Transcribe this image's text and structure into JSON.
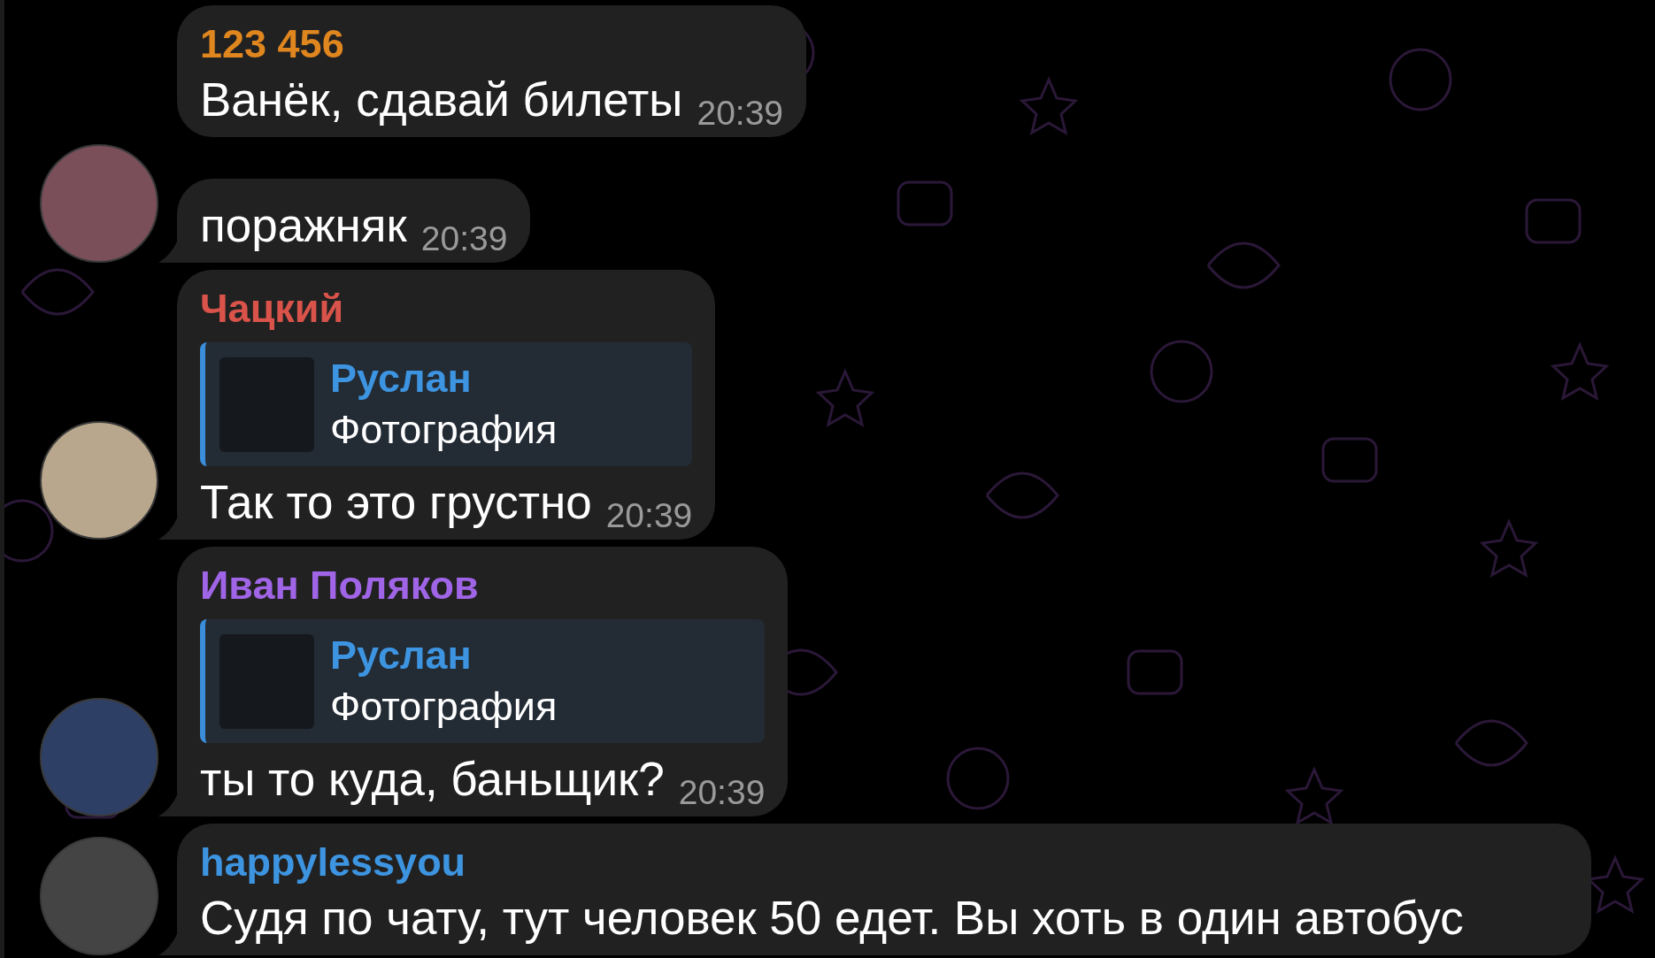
{
  "messages": [
    {
      "sender": "123 456",
      "color": "#e0861f",
      "text": "Ванёк, сдавай билеты",
      "time": "20:39",
      "avatar": false
    },
    {
      "text": "поражняк",
      "time": "20:39",
      "avatar": true
    },
    {
      "sender": "Чацкий",
      "color": "#d9534a",
      "reply": {
        "author": "Руслан",
        "text": "Фотография"
      },
      "text": "Так то это грустно",
      "time": "20:39",
      "avatar": true
    },
    {
      "sender": "Иван Поляков",
      "color": "#a065e6",
      "reply": {
        "author": "Руслан",
        "text": "Фотография"
      },
      "text": "ты то куда, баньщик?",
      "time": "20:39",
      "avatar": true
    },
    {
      "sender": "happylessyou",
      "color": "#3d94e0",
      "text": "Судя по чату, тут человек 50 едет. Вы хоть в один автобус",
      "avatar": true
    }
  ]
}
